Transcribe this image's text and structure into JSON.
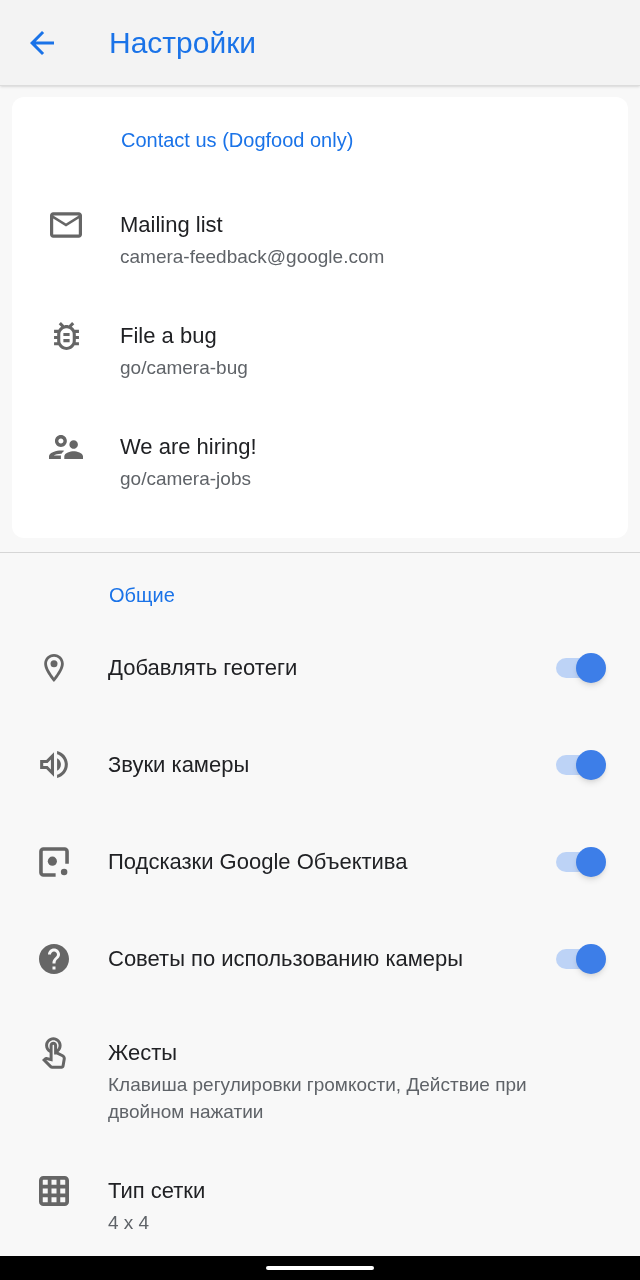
{
  "app_bar": {
    "title": "Настройки"
  },
  "contact_card": {
    "heading": "Contact us (Dogfood only)",
    "items": [
      {
        "title": "Mailing list",
        "subtitle": "camera-feedback@google.com"
      },
      {
        "title": "File a bug",
        "subtitle": "go/camera-bug"
      },
      {
        "title": "We are hiring!",
        "subtitle": "go/camera-jobs"
      }
    ]
  },
  "general": {
    "heading": "Общие",
    "items": [
      {
        "kind": "toggle",
        "title": "Добавлять геотеги",
        "on": true
      },
      {
        "kind": "toggle",
        "title": "Звуки камеры",
        "on": true
      },
      {
        "kind": "toggle",
        "title": "Подсказки Google Объектива",
        "on": true
      },
      {
        "kind": "toggle",
        "title": "Советы по использованию камеры",
        "on": true
      },
      {
        "kind": "link",
        "title": "Жесты",
        "subtitle": "Клавиша регулировки громкости, Действие при двойном нажатии"
      },
      {
        "kind": "link",
        "title": "Тип сетки",
        "subtitle": "4 x 4"
      }
    ]
  }
}
